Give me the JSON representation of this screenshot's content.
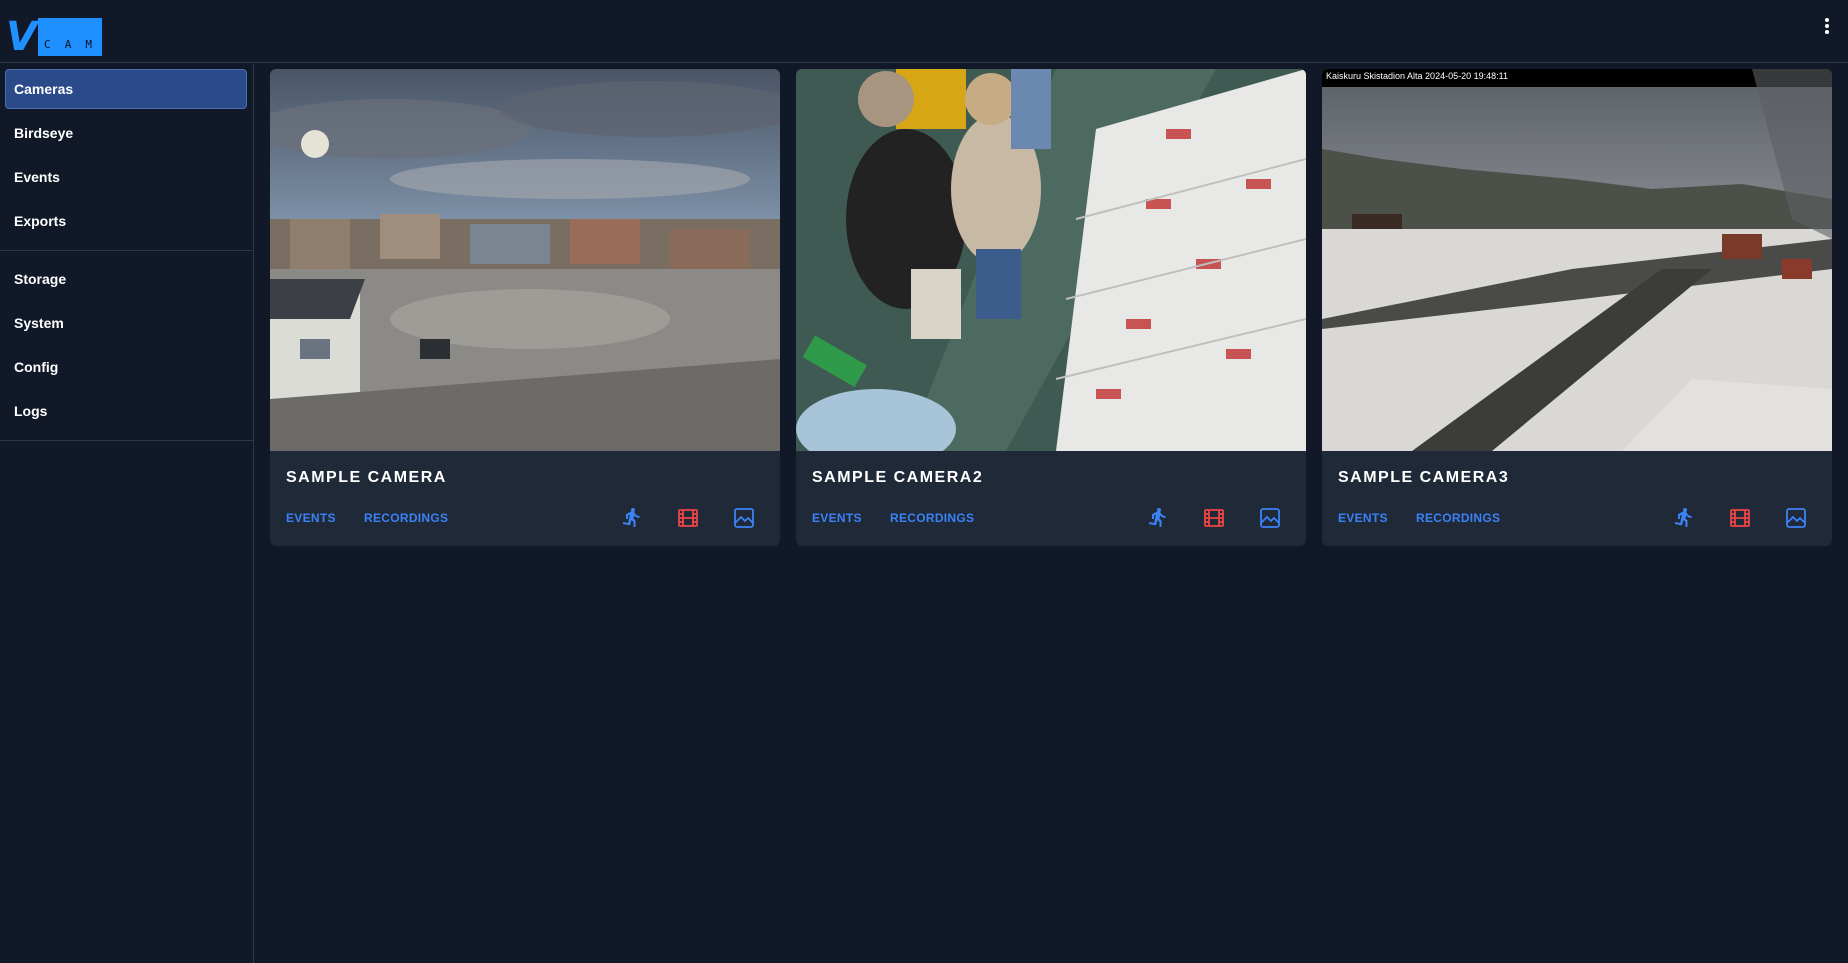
{
  "app": {
    "logo_letter": "V",
    "logo_sub": [
      "C",
      "A",
      "M"
    ]
  },
  "sidebar": {
    "primary": [
      {
        "label": "Cameras",
        "active": true
      },
      {
        "label": "Birdseye"
      },
      {
        "label": "Events"
      },
      {
        "label": "Exports"
      }
    ],
    "secondary": [
      {
        "label": "Storage"
      },
      {
        "label": "System"
      },
      {
        "label": "Config"
      },
      {
        "label": "Logs"
      }
    ]
  },
  "cameras": [
    {
      "name": "SAMPLE CAMERA",
      "events_label": "EVENTS",
      "recordings_label": "RECORDINGS",
      "icons": [
        "motion-icon",
        "recording-icon",
        "snapshot-icon"
      ]
    },
    {
      "name": "SAMPLE CAMERA2",
      "events_label": "EVENTS",
      "recordings_label": "RECORDINGS",
      "icons": [
        "motion-icon",
        "recording-icon",
        "snapshot-icon"
      ]
    },
    {
      "name": "SAMPLE CAMERA3",
      "events_label": "EVENTS",
      "recordings_label": "RECORDINGS",
      "overlay_text": "Kaiskuru Skistadion Alta 2024-05-20 19:48:11",
      "icons": [
        "motion-icon",
        "recording-icon",
        "snapshot-icon"
      ]
    }
  ],
  "colors": {
    "background": "#111827",
    "card": "#1f2937",
    "accent": "#3b82f6",
    "recording": "#ef4444",
    "active_nav": "#2a4a8a"
  }
}
